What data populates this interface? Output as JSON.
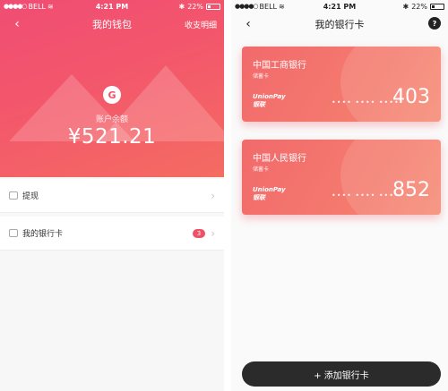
{
  "status_bar": {
    "carrier": "BELL",
    "time": "4:21 PM",
    "battery": "22%",
    "battery_level": 0.22
  },
  "wallet": {
    "title": "我的钱包",
    "header_action": "收支明细",
    "balance_label": "账户余额",
    "balance": "¥521.21",
    "menu": [
      {
        "label": "提现"
      },
      {
        "label": "我的银行卡",
        "badge": "3"
      }
    ]
  },
  "bank_cards": {
    "title": "我的银行卡",
    "help": "?",
    "cards": [
      {
        "bank": "中国工商银行",
        "type": "储蓄卡",
        "network": "UnionPay",
        "network_cn": "银联",
        "masked": "•••• •••• ••••",
        "last4": "403"
      },
      {
        "bank": "中国人民银行",
        "type": "储蓄卡",
        "network": "UnionPay",
        "network_cn": "银联",
        "masked": "•••• •••• ••••",
        "last4": "852"
      }
    ],
    "add_button": "+ 添加银行卡"
  },
  "colors": {
    "accent": "#f0566a",
    "card": "#f47a6e",
    "button_dark": "#2b2b2b"
  }
}
